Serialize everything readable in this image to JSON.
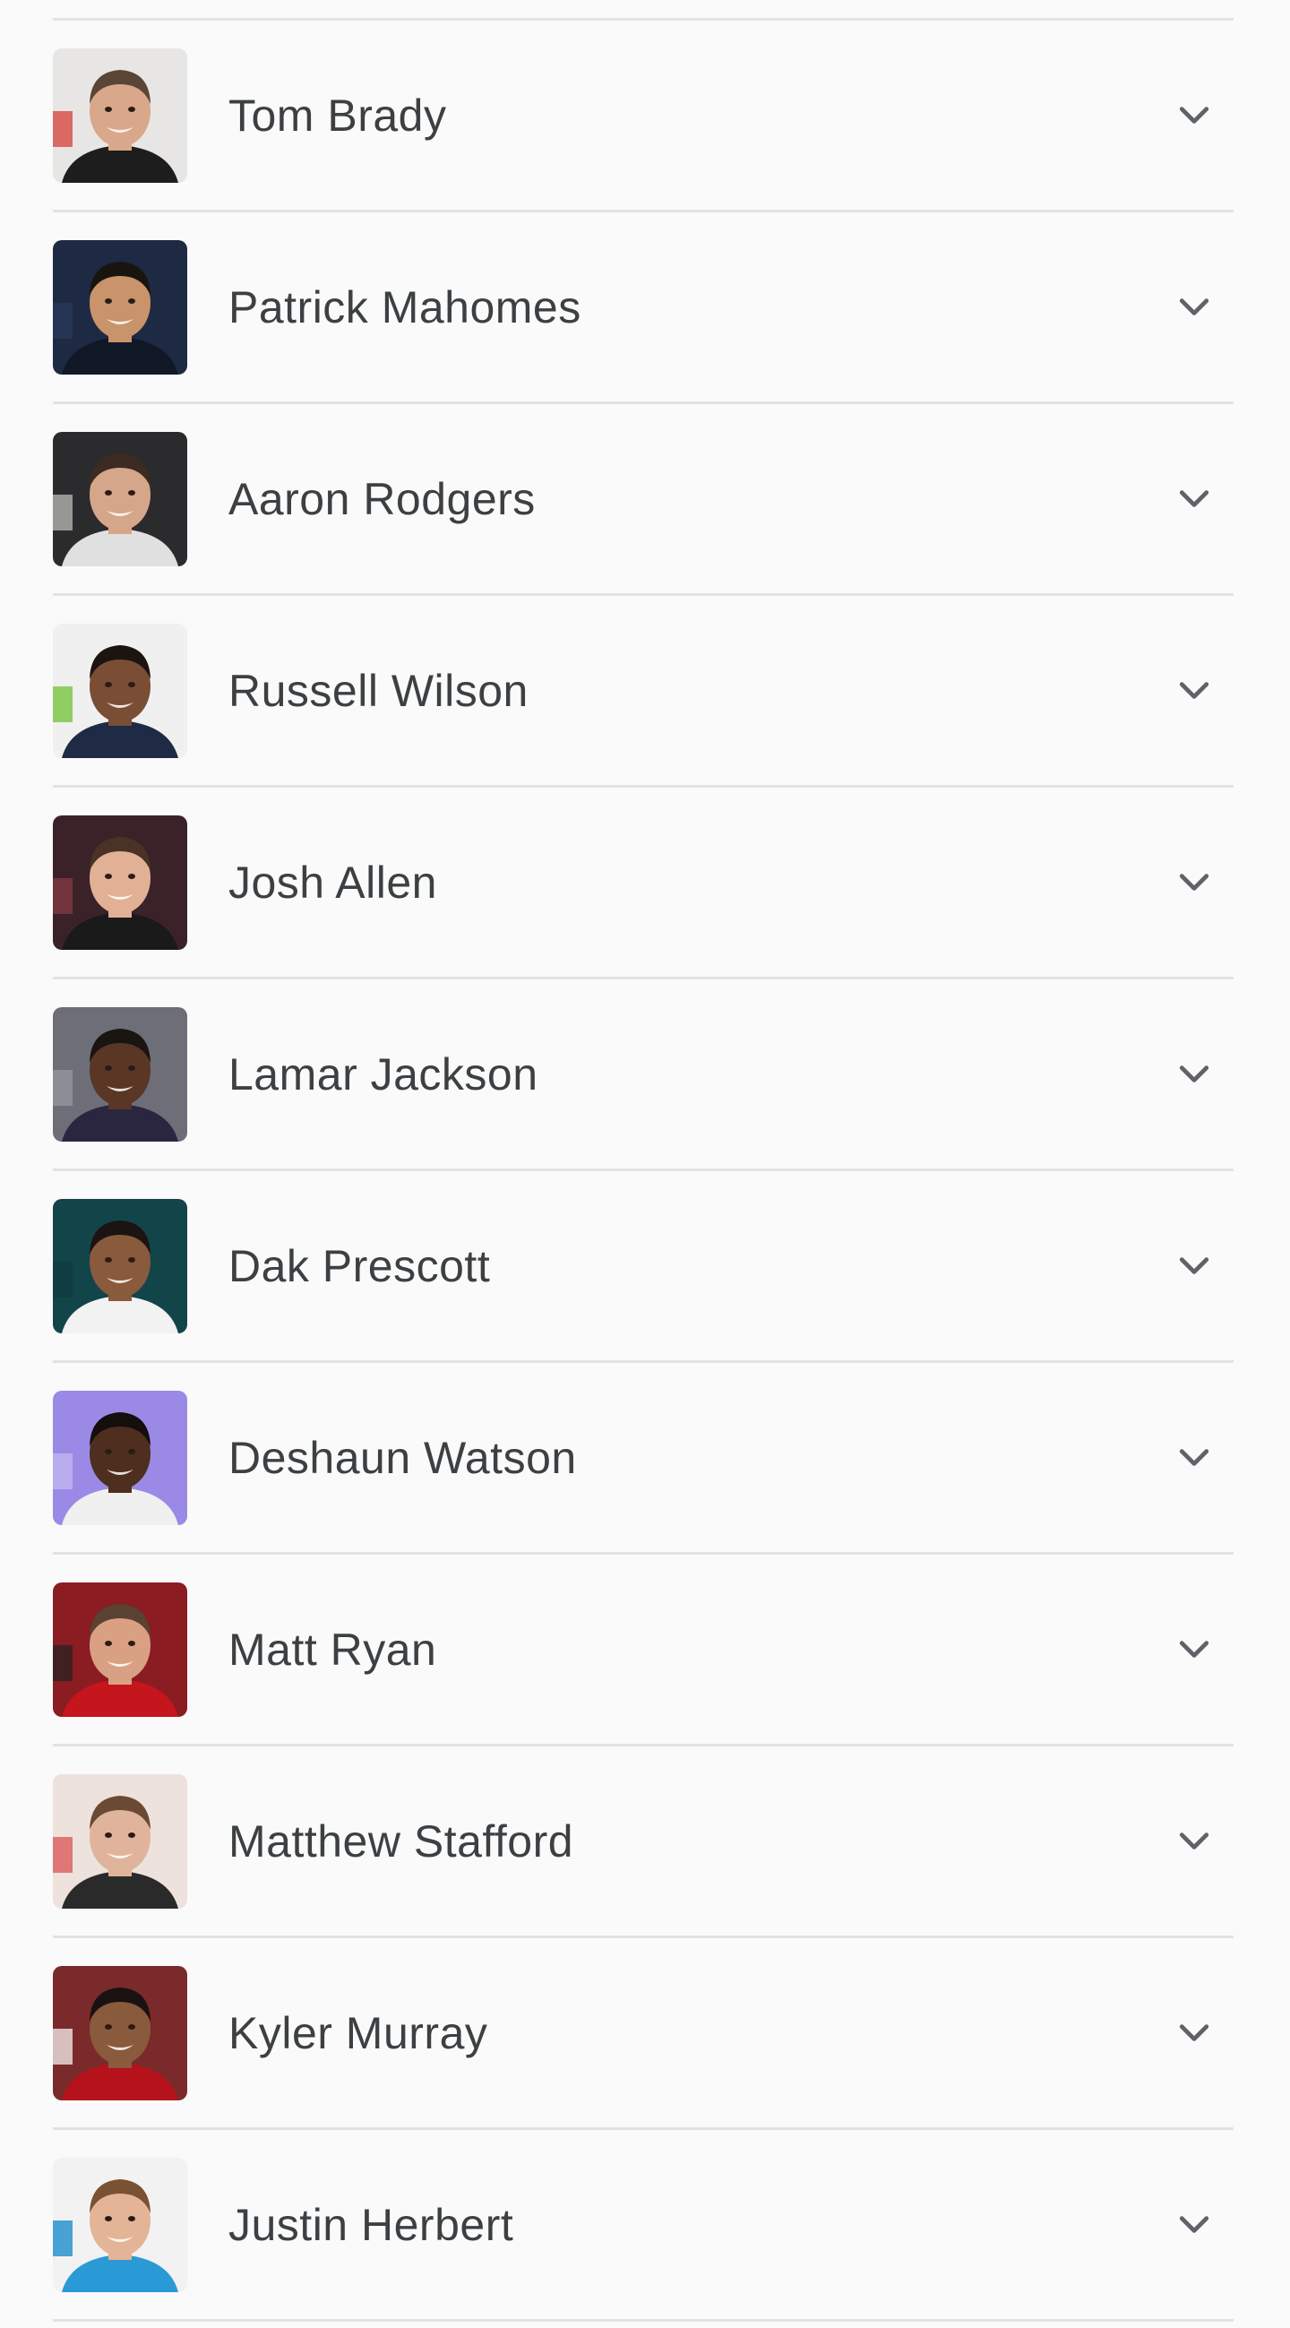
{
  "players": [
    {
      "name": "Tom Brady",
      "bg": "#e8e6e4",
      "skin": "#d9a88a",
      "hair": "#5a4636",
      "shirt": "#1d1d1d",
      "accent": "#d6332c"
    },
    {
      "name": "Patrick Mahomes",
      "bg": "#1e2a44",
      "skin": "#c9946b",
      "hair": "#1a1410",
      "shirt": "#101828",
      "accent": "#2a3a5c"
    },
    {
      "name": "Aaron Rodgers",
      "bg": "#2b2b2e",
      "skin": "#d6a68a",
      "hair": "#3b2b22",
      "shirt": "#e0e0e0",
      "accent": "#c9c6c0"
    },
    {
      "name": "Russell Wilson",
      "bg": "#f0f0f0",
      "skin": "#7a4e34",
      "hair": "#1b1410",
      "shirt": "#1f2a44",
      "accent": "#69be28"
    },
    {
      "name": "Josh Allen",
      "bg": "#3a2228",
      "skin": "#e2b195",
      "hair": "#4a3226",
      "shirt": "#1a1a1a",
      "accent": "#8a3a44"
    },
    {
      "name": "Lamar Jackson",
      "bg": "#6e6e78",
      "skin": "#5a3624",
      "hair": "#1a1412",
      "shirt": "#2a2640",
      "accent": "#9a9aa4"
    },
    {
      "name": "Dak Prescott",
      "bg": "#12454a",
      "skin": "#8a5a3c",
      "hair": "#1a1412",
      "shirt": "#f2f2f2",
      "accent": "#0e3a3e"
    },
    {
      "name": "Deshaun Watson",
      "bg": "#9a8ae6",
      "skin": "#4e2e1e",
      "hair": "#140e0c",
      "shirt": "#f0f0f0",
      "accent": "#c6bcf4"
    },
    {
      "name": "Matt Ryan",
      "bg": "#8a1c22",
      "skin": "#d9a084",
      "hair": "#5a4232",
      "shirt": "#c4161c",
      "accent": "#222222"
    },
    {
      "name": "Matthew Stafford",
      "bg": "#ede2dc",
      "skin": "#e0b49a",
      "hair": "#6a4a34",
      "shirt": "#2a2a2a",
      "accent": "#d84a4a"
    },
    {
      "name": "Kyler Murray",
      "bg": "#7a2a2a",
      "skin": "#8a5a3c",
      "hair": "#1a1210",
      "shirt": "#b5121b",
      "accent": "#ffffff"
    },
    {
      "name": "Justin Herbert",
      "bg": "#f2f2f2",
      "skin": "#e4b496",
      "hair": "#7a5232",
      "shirt": "#2a9ad6",
      "accent": "#0080c6"
    }
  ]
}
